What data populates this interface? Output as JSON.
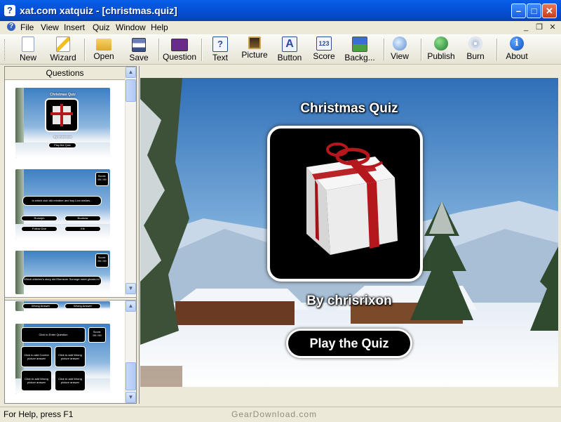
{
  "window": {
    "title": "xat.com xatquiz - [christmas.quiz]",
    "minimize": "–",
    "maximize": "□",
    "close": "✕"
  },
  "menu": {
    "items": [
      "File",
      "View",
      "Insert",
      "Quiz",
      "Window",
      "Help"
    ],
    "mdi": {
      "minimize": "_",
      "restore": "❐",
      "close": "✕"
    }
  },
  "toolbar": {
    "buttons": [
      {
        "label": "New",
        "icon": "new-document-icon"
      },
      {
        "label": "Wizard",
        "icon": "wizard-icon"
      },
      {
        "label": "Open",
        "icon": "open-folder-icon"
      },
      {
        "label": "Save",
        "icon": "save-disk-icon"
      },
      {
        "label": "Question",
        "icon": "question-icon"
      },
      {
        "label": "Text",
        "icon": "text-icon",
        "glyph": "?"
      },
      {
        "label": "Picture",
        "icon": "picture-icon"
      },
      {
        "label": "Button",
        "icon": "button-icon",
        "glyph": "A"
      },
      {
        "label": "Score",
        "icon": "score-icon",
        "glyph": "123"
      },
      {
        "label": "Backg...",
        "icon": "background-icon"
      },
      {
        "label": "View",
        "icon": "view-icon"
      },
      {
        "label": "Publish",
        "icon": "publish-globe-icon"
      },
      {
        "label": "Burn",
        "icon": "burn-cd-icon"
      },
      {
        "label": "About",
        "icon": "about-info-icon",
        "glyph": "i"
      }
    ]
  },
  "questions_panel": {
    "header": "Questions",
    "slides": [
      {
        "title": "Christmas Quiz",
        "author": "By chrisrixon",
        "button": "Play the Quiz"
      },
      {
        "score_label": "Score:",
        "score": "99 / 99",
        "question": "In which club did reindeer and boy Lion wishes...",
        "answers": [
          "Rudolph",
          "Bucklow",
          "Follow Doe",
          "Elk"
        ]
      },
      {
        "score_label": "Score:",
        "score": "99 / 99",
        "question": "Which children's story did Ebenezer Scrooge meet ghosts in?"
      },
      {
        "answers": [
          "Wrong Answer",
          "Wrong Answer"
        ]
      },
      {
        "question": "Click to Enter Question",
        "score_label": "Score:",
        "score": "99 / 99",
        "answers": [
          "Click to add Correct picture answer",
          "Click to add Wrong picture answer",
          "Click to add Wrong picture answer",
          "Click to add Wrong picture answer"
        ]
      }
    ]
  },
  "quiz_canvas": {
    "title": "Christmas Quiz",
    "author": "By chrisrixon",
    "play_button": "Play the Quiz"
  },
  "status": {
    "help": "For Help, press F1",
    "watermark": "GearDownload.com"
  },
  "colors": {
    "titlebar": "#0553d9",
    "ribbon": "#b5181c",
    "sky": "#3d7fc3",
    "pill": "#000000"
  }
}
